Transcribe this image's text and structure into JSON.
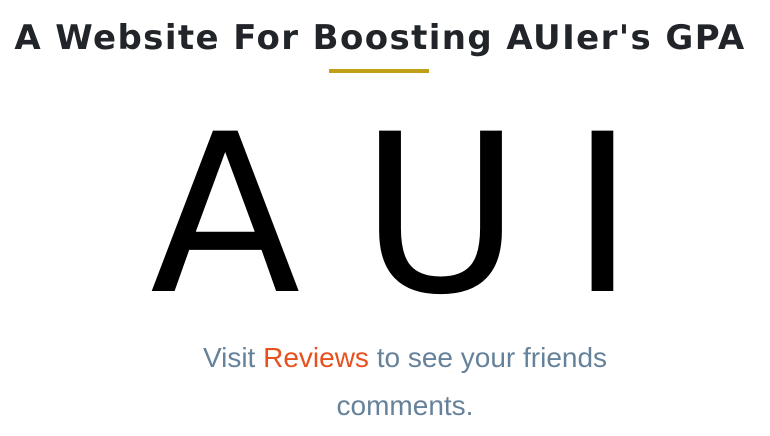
{
  "header": {
    "title": "A Website For Boosting AUIer's GPA",
    "accent_color": "#c19f17"
  },
  "logo": {
    "letters": [
      "A",
      "U",
      "I"
    ]
  },
  "message": {
    "before": "Visit ",
    "link_text": "Reviews",
    "after": " to see your friends comments.",
    "text_color": "#66829a",
    "link_color": "#e8501e"
  }
}
